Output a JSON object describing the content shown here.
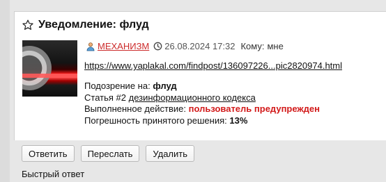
{
  "notification": {
    "title": "Уведомление: флуд",
    "author": "МЕХАНИЗМ",
    "date": "26.08.2024 17:32",
    "to_label": "Кому:",
    "to_value": "мне",
    "link": "https://www.yaplakal.com/findpost/136097226...pic2820974.html",
    "suspicion_label": "Подозрение на:",
    "suspicion_value": "флуд",
    "article_prefix": "Статья #2",
    "article_link": "дезинформационного кодекса",
    "action_label": "Выполненное действие:",
    "action_value": "пользователь предупрежден",
    "error_label": "Погрешность принятого решения:",
    "error_value": "13%"
  },
  "buttons": {
    "reply": "Ответить",
    "forward": "Переслать",
    "delete": "Удалить"
  },
  "quick_reply": "Быстрый ответ",
  "icons": {
    "star": "star-outline-icon",
    "user": "user-icon",
    "clock": "clock-icon"
  },
  "colors": {
    "accent_red": "#d21a1a",
    "author_red": "#cc2b2b",
    "background": "#e7e7e7"
  }
}
